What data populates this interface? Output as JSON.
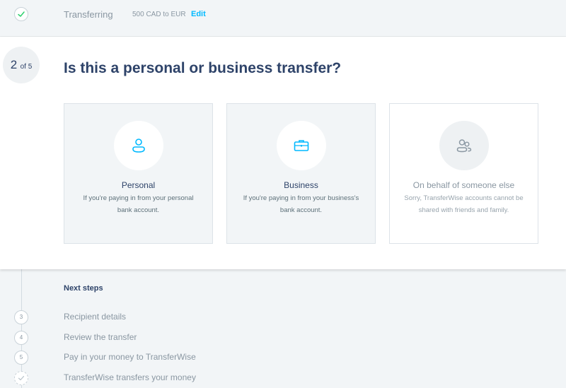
{
  "completed_step": {
    "label": "Transferring",
    "amount": "500 CAD to EUR",
    "edit_label": "Edit"
  },
  "current_step": {
    "number": "2",
    "of_label": "of 5",
    "question": "Is this a personal or business transfer?"
  },
  "options": [
    {
      "title": "Personal",
      "description": "If you're paying in from your personal bank account.",
      "icon": "person-icon"
    },
    {
      "title": "Business",
      "description": "If you're paying in from your business's bank account.",
      "icon": "briefcase-icon"
    },
    {
      "title": "On behalf of someone else",
      "description": "Sorry, TransferWise accounts cannot be shared with friends and family.",
      "icon": "people-icon"
    }
  ],
  "next_steps": {
    "title": "Next steps",
    "items": [
      {
        "number": "3",
        "label": "Recipient details"
      },
      {
        "number": "4",
        "label": "Review the transfer"
      },
      {
        "number": "5",
        "label": "Pay in your money to TransferWise"
      },
      {
        "number": "",
        "label": "TransferWise transfers your money"
      }
    ]
  },
  "colors": {
    "accent": "#00b9ff",
    "primary_text": "#2e4369",
    "muted_text": "#8a97a2",
    "check_green": "#2ed06e"
  }
}
